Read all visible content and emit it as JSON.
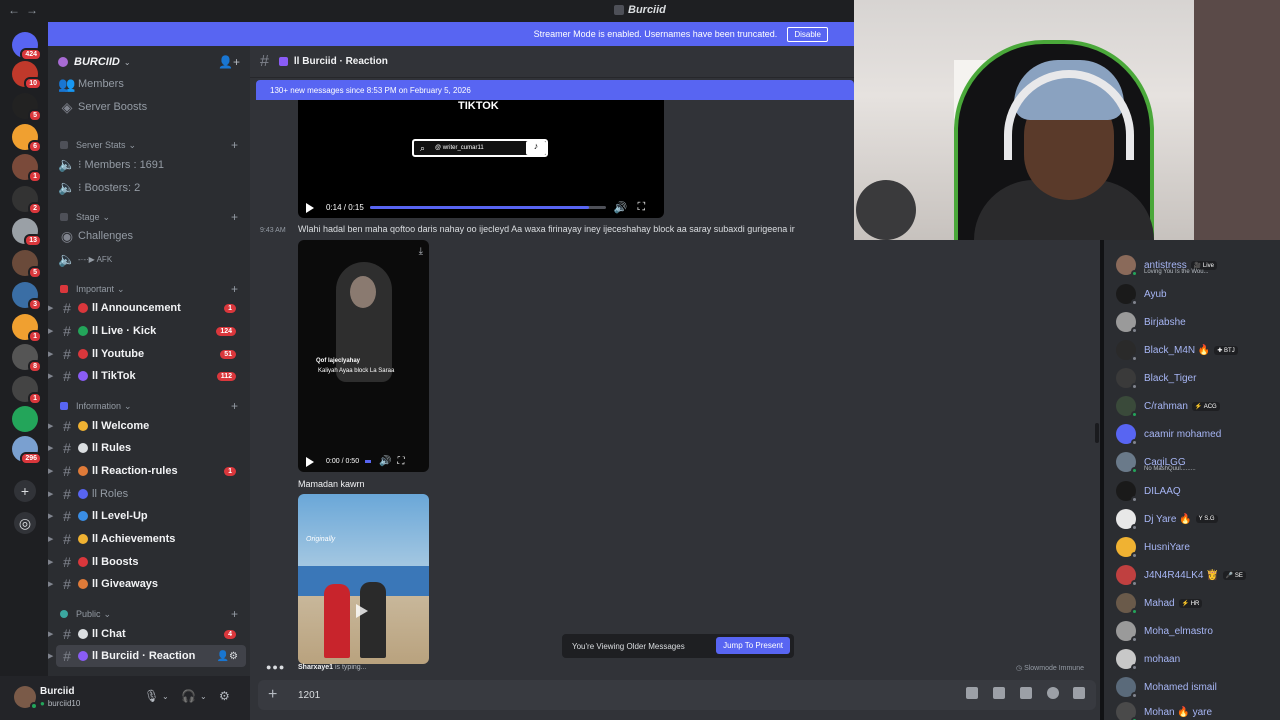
{
  "window": {
    "title": "Burciid"
  },
  "streamer_banner": {
    "text": "Streamer Mode is enabled. Usernames have been truncated.",
    "disable_label": "Disable"
  },
  "server": {
    "name": "BURCIID"
  },
  "rail": {
    "servers": [
      {
        "badge": "424",
        "color": "#5865f2"
      },
      {
        "badge": "10",
        "color": "#c0392b"
      },
      {
        "badge": "5",
        "color": "#222222"
      },
      {
        "badge": "6",
        "color": "#f0a030"
      },
      {
        "badge": "1",
        "color": "#7a4a3a"
      },
      {
        "badge": "2",
        "color": "#333333"
      },
      {
        "badge": "13",
        "color": "#9aa0a6"
      },
      {
        "badge": "5",
        "color": "#6a4a3a"
      },
      {
        "badge": "3",
        "color": "#3a6ea5"
      },
      {
        "badge": "1",
        "color": "#f0a030"
      },
      {
        "badge": "8",
        "color": "#555555"
      },
      {
        "badge": "1",
        "color": "#444444"
      },
      {
        "badge": "",
        "color": "#23a55a"
      },
      {
        "badge": "296",
        "color": "#7aa0d0"
      }
    ],
    "add_label": "+",
    "discover_label": "◎"
  },
  "sidebar": {
    "top_items": [
      "Members",
      "Server Boosts"
    ],
    "categories": [
      {
        "label": "Server Stats",
        "color": "#4e5058"
      },
      {
        "label": "Stage",
        "color": "#4e5058"
      },
      {
        "label": "Important",
        "color": "#da373c"
      },
      {
        "label": "Information",
        "color": "#5865f2"
      },
      {
        "label": "Public",
        "color": "#3ba7a0"
      }
    ],
    "stats": [
      "⁝ Members : 1691",
      "⁝ Boosters: 2"
    ],
    "stage": [
      "Challenges",
      "-·-·▶ AFK"
    ],
    "channels": [
      {
        "label": "ll Announcement",
        "count": "1",
        "color": "#da373c"
      },
      {
        "label": "ll Live · Kick",
        "count": "124",
        "color": "#23a55a"
      },
      {
        "label": "ll Youtube",
        "count": "51",
        "color": "#da373c"
      },
      {
        "label": "ll TikTok",
        "count": "112",
        "color": "#8a5cf6"
      },
      {
        "label": "ll Welcome",
        "count": "",
        "color": "#f0b232"
      },
      {
        "label": "ll Rules",
        "count": "",
        "color": "#dbdee1"
      },
      {
        "label": "ll Reaction-rules",
        "count": "1",
        "color": "#e07b39"
      },
      {
        "label": "ll Roles",
        "count": "",
        "color": "#5865f2"
      },
      {
        "label": "ll Level-Up",
        "count": "",
        "color": "#3a8ee6"
      },
      {
        "label": "ll Achievements",
        "count": "",
        "color": "#f0b232"
      },
      {
        "label": "ll Boosts",
        "count": "",
        "color": "#da373c"
      },
      {
        "label": "ll Giveaways",
        "count": "",
        "color": "#e07b39"
      },
      {
        "label": "ll Chat",
        "count": "4",
        "color": "#dbdee1"
      },
      {
        "label": "ll Burciid · Reaction",
        "count": "",
        "color": "#8a5cf6"
      }
    ]
  },
  "user": {
    "name": "Burciid",
    "tag": "burciid10"
  },
  "channel_header": {
    "title": "ll Burciid · Reaction"
  },
  "new_messages": {
    "text": "130+ new messages since 8:53 PM on February 5, 2026"
  },
  "video1": {
    "heading": "TIKTOK",
    "handle": "@ writer_cumar11",
    "time": "0:14 / 0:15",
    "progress": 0.93
  },
  "message": {
    "time": "9:43 AM",
    "text": "Wlahi hadal ben maha qoftoo daris nahay  oo ijecleyd Aa waxa firinayay iney ijeceshahay block aa saray subaxdi gurigeena ir"
  },
  "video2": {
    "caption1": "Qof lajeclyahay",
    "caption2": "Kaliyah Ayaa block La Saraa",
    "time": "0:00 / 0:50",
    "progress": 0.0
  },
  "author": {
    "name": "Mamadan kawrn"
  },
  "video3": {
    "caption": "Originally"
  },
  "older_banner": {
    "text": "You're Viewing Older Messages",
    "jump_label": "Jump To Present"
  },
  "typing": {
    "user": "Sharxaye1",
    "suffix": " is typing..."
  },
  "slowmode": {
    "text": "Slowmode Immune"
  },
  "composer": {
    "value": "1201"
  },
  "members": [
    {
      "name": "antistress",
      "tag": "🎥 Live",
      "sub": "Loving You Is the Wou...",
      "color": "#8a6a5a",
      "status": "#23a55a"
    },
    {
      "name": "Ayub",
      "tag": "",
      "sub": "",
      "color": "#1a1a1a",
      "status": "#80848e"
    },
    {
      "name": "Birjabshe",
      "tag": "",
      "sub": "",
      "color": "#9a9a9a",
      "status": "#80848e"
    },
    {
      "name": "Black_M4N 🔥",
      "tag": "✚ BTJ",
      "sub": "",
      "color": "#2a2a2a",
      "status": "#80848e"
    },
    {
      "name": "Black_Tiger",
      "tag": "",
      "sub": "",
      "color": "#3a3a3a",
      "status": "#80848e"
    },
    {
      "name": "C/rahman",
      "tag": "⚡ ACG",
      "sub": "",
      "color": "#3a4a3a",
      "status": "#23a55a"
    },
    {
      "name": "caamir mohamed",
      "tag": "",
      "sub": "",
      "color": "#5865f2",
      "status": "#80848e"
    },
    {
      "name": "CaqiLGG",
      "tag": "",
      "sub": "No MashQuul.........",
      "color": "#6a7a8a",
      "status": "#23a55a"
    },
    {
      "name": "DILAAQ",
      "tag": "",
      "sub": "",
      "color": "#1a1a1a",
      "status": "#80848e"
    },
    {
      "name": "Dj Yare 🔥",
      "tag": "Y S.G",
      "sub": "",
      "color": "#e8e8e8",
      "status": "#80848e"
    },
    {
      "name": "HusniYare",
      "tag": "",
      "sub": "",
      "color": "#f0b232",
      "status": "#80848e"
    },
    {
      "name": "J4N4R44LK4 👸",
      "tag": "🎤 SE",
      "sub": "",
      "color": "#c04040",
      "status": "#80848e"
    },
    {
      "name": "Mahad",
      "tag": "⚡ HR",
      "sub": "",
      "color": "#6a5a4a",
      "status": "#23a55a"
    },
    {
      "name": "Moha_elmastro",
      "tag": "",
      "sub": "",
      "color": "#9a9a9a",
      "status": "#80848e"
    },
    {
      "name": "mohaan",
      "tag": "",
      "sub": "",
      "color": "#c8c8c8",
      "status": "#80848e"
    },
    {
      "name": "Mohamed ismail",
      "tag": "",
      "sub": "",
      "color": "#5a6a7a",
      "status": "#80848e"
    },
    {
      "name": "Mohan 🔥 yare",
      "tag": "",
      "sub": "",
      "color": "#4a4a4a",
      "status": "#23a55a"
    }
  ]
}
